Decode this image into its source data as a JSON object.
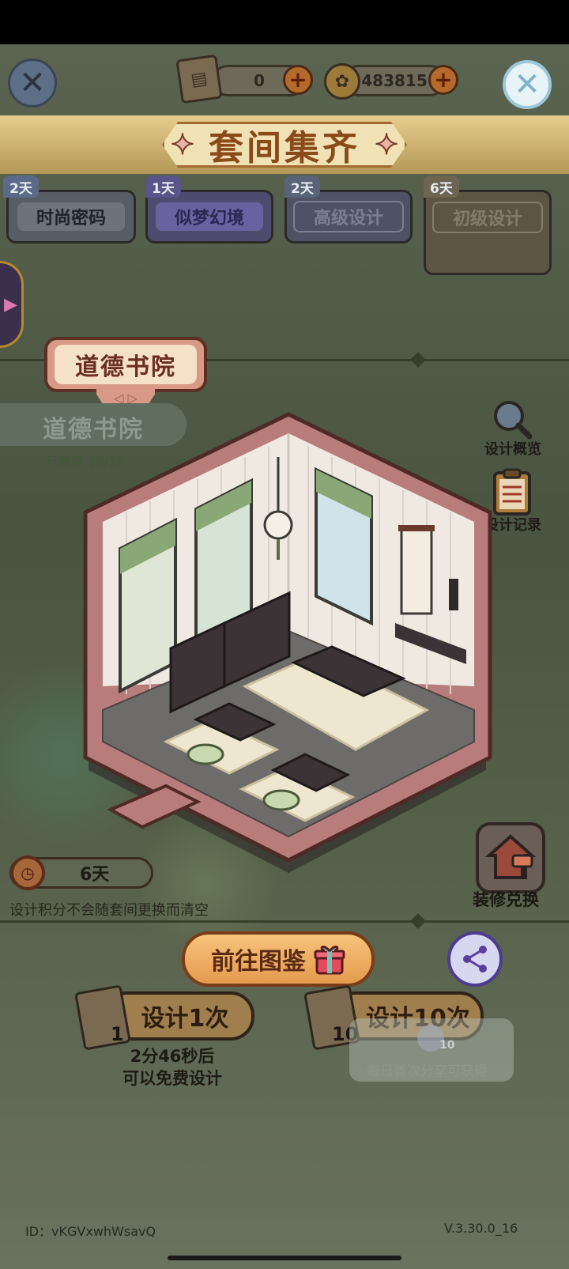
{
  "header": {
    "scroll_count": "0",
    "coin_count": "483815",
    "title": "套间集齐"
  },
  "tabs": [
    {
      "label": "时尚密码",
      "badge": "2天"
    },
    {
      "label": "似梦幻境",
      "badge": "1天"
    },
    {
      "label": "高级设计",
      "badge": "2天"
    },
    {
      "label": "初级设计",
      "badge": "6天"
    }
  ],
  "room": {
    "tag": "道德书院",
    "subtitle": "道德书院",
    "collected": "已收集 18/18"
  },
  "side": {
    "overview_label": "设计概览",
    "record_label": "设计记录",
    "exchange_label": "装修兑换"
  },
  "timer": {
    "value": "6天",
    "note": "设计积分不会随套间更换而清空"
  },
  "actions": {
    "guide_label": "前往图鉴",
    "design_once_label": "设计1次",
    "design_once_cost": "1",
    "design_ten_label": "设计10次",
    "design_ten_cost": "10",
    "free_line1": "2分46秒后",
    "free_line2": "可以免费设计",
    "share_tip": "每日首次分享可获得",
    "share_reward": "10"
  },
  "footer": {
    "id": "ID：vKGVxwhWsavQ",
    "version": "V.3.30.0_16"
  },
  "colors": {
    "accent": "#e59a4e",
    "banner": "#d6bb78",
    "room_frame": "#b97c7c",
    "overlay": "#4f5a46"
  }
}
